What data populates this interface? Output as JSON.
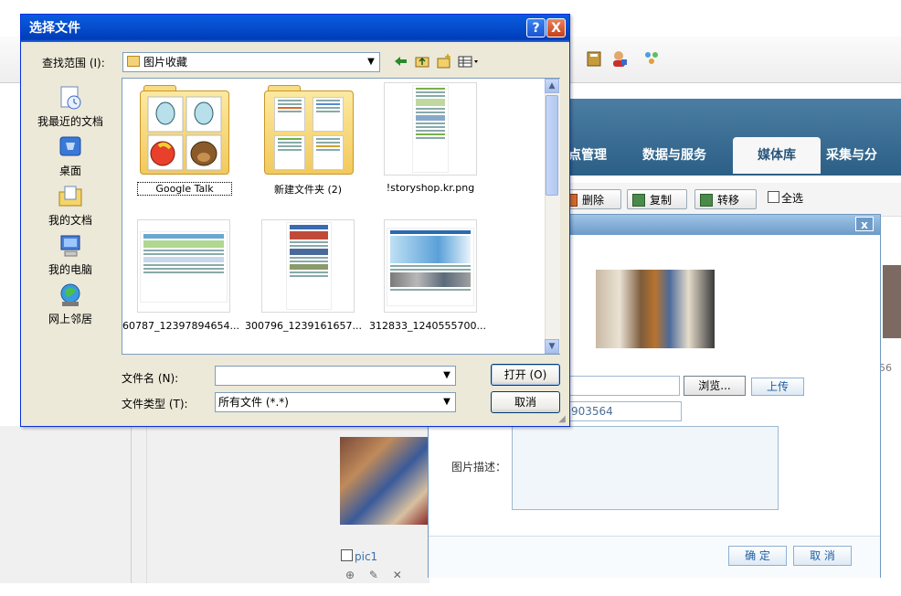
{
  "background_app": {
    "tabs": [
      "点管理",
      "数据与服务",
      "媒体库",
      "采集与分"
    ],
    "active_tab": "媒体库",
    "actions": {
      "delete": "删除",
      "copy": "复制",
      "move": "转移",
      "select_all": "全选"
    },
    "item_label": "pic1",
    "item_tools": "⊕ ✎ ✕",
    "right_number": "56"
  },
  "upload_modal": {
    "close_label": "x",
    "browse_label": "浏览...",
    "upload_label": "上传",
    "id_value": "903564",
    "description_label": "图片描述：",
    "ok_label": "确 定",
    "cancel_label": "取 消"
  },
  "file_dialog": {
    "title": "选择文件",
    "help_label": "?",
    "close_label": "X",
    "look_in_label": "查找范围 (I):",
    "look_in_value": "图片收藏",
    "places": [
      "我最近的文档",
      "桌面",
      "我的文档",
      "我的电脑",
      "网上邻居"
    ],
    "files": [
      {
        "name": "Google Talk",
        "kind": "folder"
      },
      {
        "name": "新建文件夹 (2)",
        "kind": "folder"
      },
      {
        "name": "!storyshop.kr.png",
        "kind": "image"
      },
      {
        "name": "60787_12397894654...",
        "kind": "image"
      },
      {
        "name": "300796_1239161657...",
        "kind": "image"
      },
      {
        "name": "312833_1240555700...",
        "kind": "image"
      }
    ],
    "filename_label": "文件名 (N):",
    "filename_value": "",
    "filetype_label": "文件类型 (T):",
    "filetype_value": "所有文件 (*.*)",
    "open_label": "打开 (O)",
    "cancel_label": "取消"
  },
  "icons": [
    "back-arrow-icon",
    "up-folder-icon",
    "new-folder-icon",
    "view-menu-icon"
  ],
  "colors": {
    "titlebar": "#0550d0",
    "dialog_bg": "#ece9d8",
    "header_blue": "#2c5f86"
  }
}
